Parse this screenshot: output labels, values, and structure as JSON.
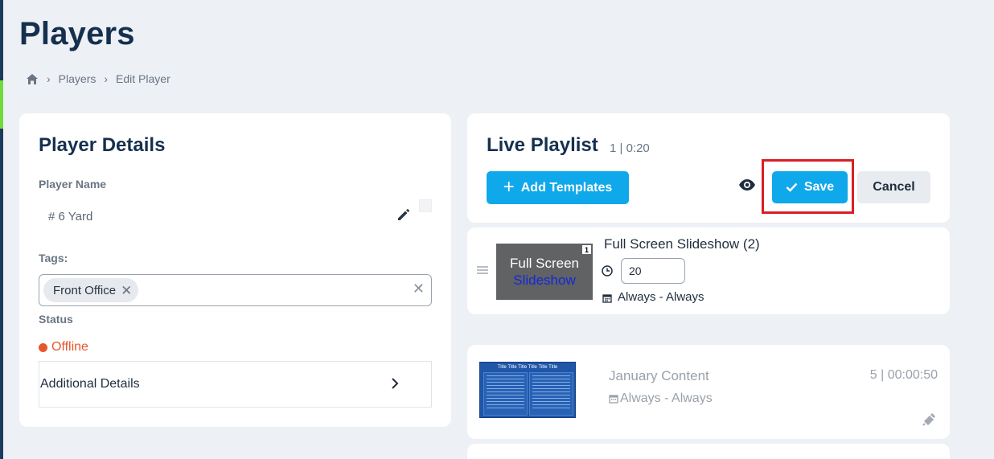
{
  "page": {
    "title": "Players"
  },
  "breadcrumb": {
    "items": [
      "Players",
      "Edit Player"
    ]
  },
  "player_details": {
    "title": "Player Details",
    "name_label": "Player Name",
    "name_value": "# 6 Yard",
    "tags_label": "Tags:",
    "tags": [
      "Front Office"
    ],
    "status_label": "Status",
    "status_value": "Offline",
    "additional_label": "Additional Details"
  },
  "live_playlist": {
    "title": "Live Playlist",
    "meta": "1 | 0:20",
    "add_button": "Add Templates",
    "save_button": "Save",
    "cancel_button": "Cancel",
    "items": [
      {
        "title": "Full Screen Slideshow (2)",
        "thumb_line1": "Full Screen",
        "thumb_line2": "Slideshow",
        "thumb_badge": "1",
        "duration": "20",
        "schedule": "Always - Always"
      }
    ]
  },
  "playlists": [
    {
      "title": "January Content",
      "count": "5 | 00:00:50",
      "schedule": "Always - Always",
      "thumb_title": "Title Title Title Title Title Title"
    }
  ],
  "colors": {
    "accent": "#0fa8ea",
    "offline": "#e8572a",
    "highlight": "#d81f26",
    "navy": "#15304f"
  }
}
